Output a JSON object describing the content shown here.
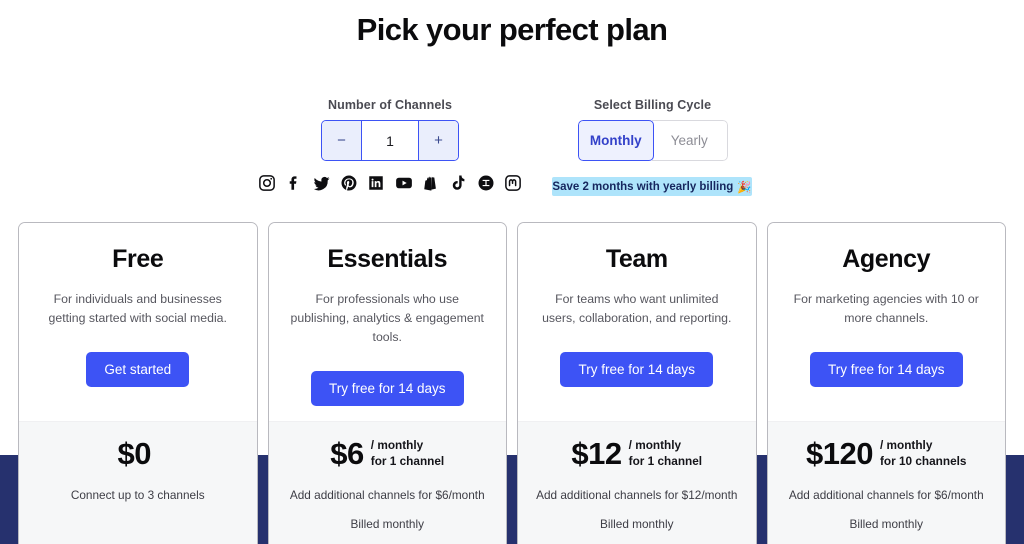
{
  "page": {
    "title": "Pick your perfect plan",
    "background": "#ffffff",
    "accent_color": "#3d53f5",
    "navy_band_color": "#26316e"
  },
  "controls": {
    "channels": {
      "label": "Number of Channels",
      "decrement_label": "−",
      "increment_label": "+",
      "value": "1"
    },
    "billing": {
      "label": "Select Billing Cycle",
      "options": [
        {
          "label": "Monthly",
          "selected": true
        },
        {
          "label": "Yearly",
          "selected": false
        }
      ]
    },
    "save_badge": {
      "text": "Save 2 months with yearly billing",
      "emoji": "🎉",
      "background": "#aee4fb",
      "text_color": "#16265e"
    }
  },
  "socials": [
    {
      "name": "instagram-icon"
    },
    {
      "name": "facebook-icon"
    },
    {
      "name": "twitter-icon"
    },
    {
      "name": "pinterest-icon"
    },
    {
      "name": "linkedin-icon"
    },
    {
      "name": "youtube-icon"
    },
    {
      "name": "shopify-icon"
    },
    {
      "name": "tiktok-icon"
    },
    {
      "name": "threads-icon"
    },
    {
      "name": "mastodon-icon"
    }
  ],
  "plans": [
    {
      "id": "free",
      "title": "Free",
      "description": "For individuals and businesses getting started with social media.",
      "cta": "Get started",
      "price": "$0",
      "unit_line1": "",
      "unit_line2": "",
      "note": "Connect up to 3 channels",
      "billed": ""
    },
    {
      "id": "essentials",
      "title": "Essentials",
      "description": "For professionals who use publishing, analytics & engagement tools.",
      "cta": "Try free for 14 days",
      "price": "$6",
      "unit_line1": "/ monthly",
      "unit_line2": "for 1 channel",
      "note": "Add additional channels for $6/month",
      "billed": "Billed monthly"
    },
    {
      "id": "team",
      "title": "Team",
      "description": "For teams who want unlimited users, collaboration, and reporting.",
      "cta": "Try free for 14 days",
      "price": "$12",
      "unit_line1": "/ monthly",
      "unit_line2": "for 1 channel",
      "note": "Add additional channels for $12/month",
      "billed": "Billed monthly"
    },
    {
      "id": "agency",
      "title": "Agency",
      "description": "For marketing agencies with 10 or more channels.",
      "cta": "Try free for 14 days",
      "price": "$120",
      "unit_line1": "/ monthly",
      "unit_line2": "for 10 channels",
      "note": "Add additional channels for $6/month",
      "billed": "Billed monthly"
    }
  ]
}
